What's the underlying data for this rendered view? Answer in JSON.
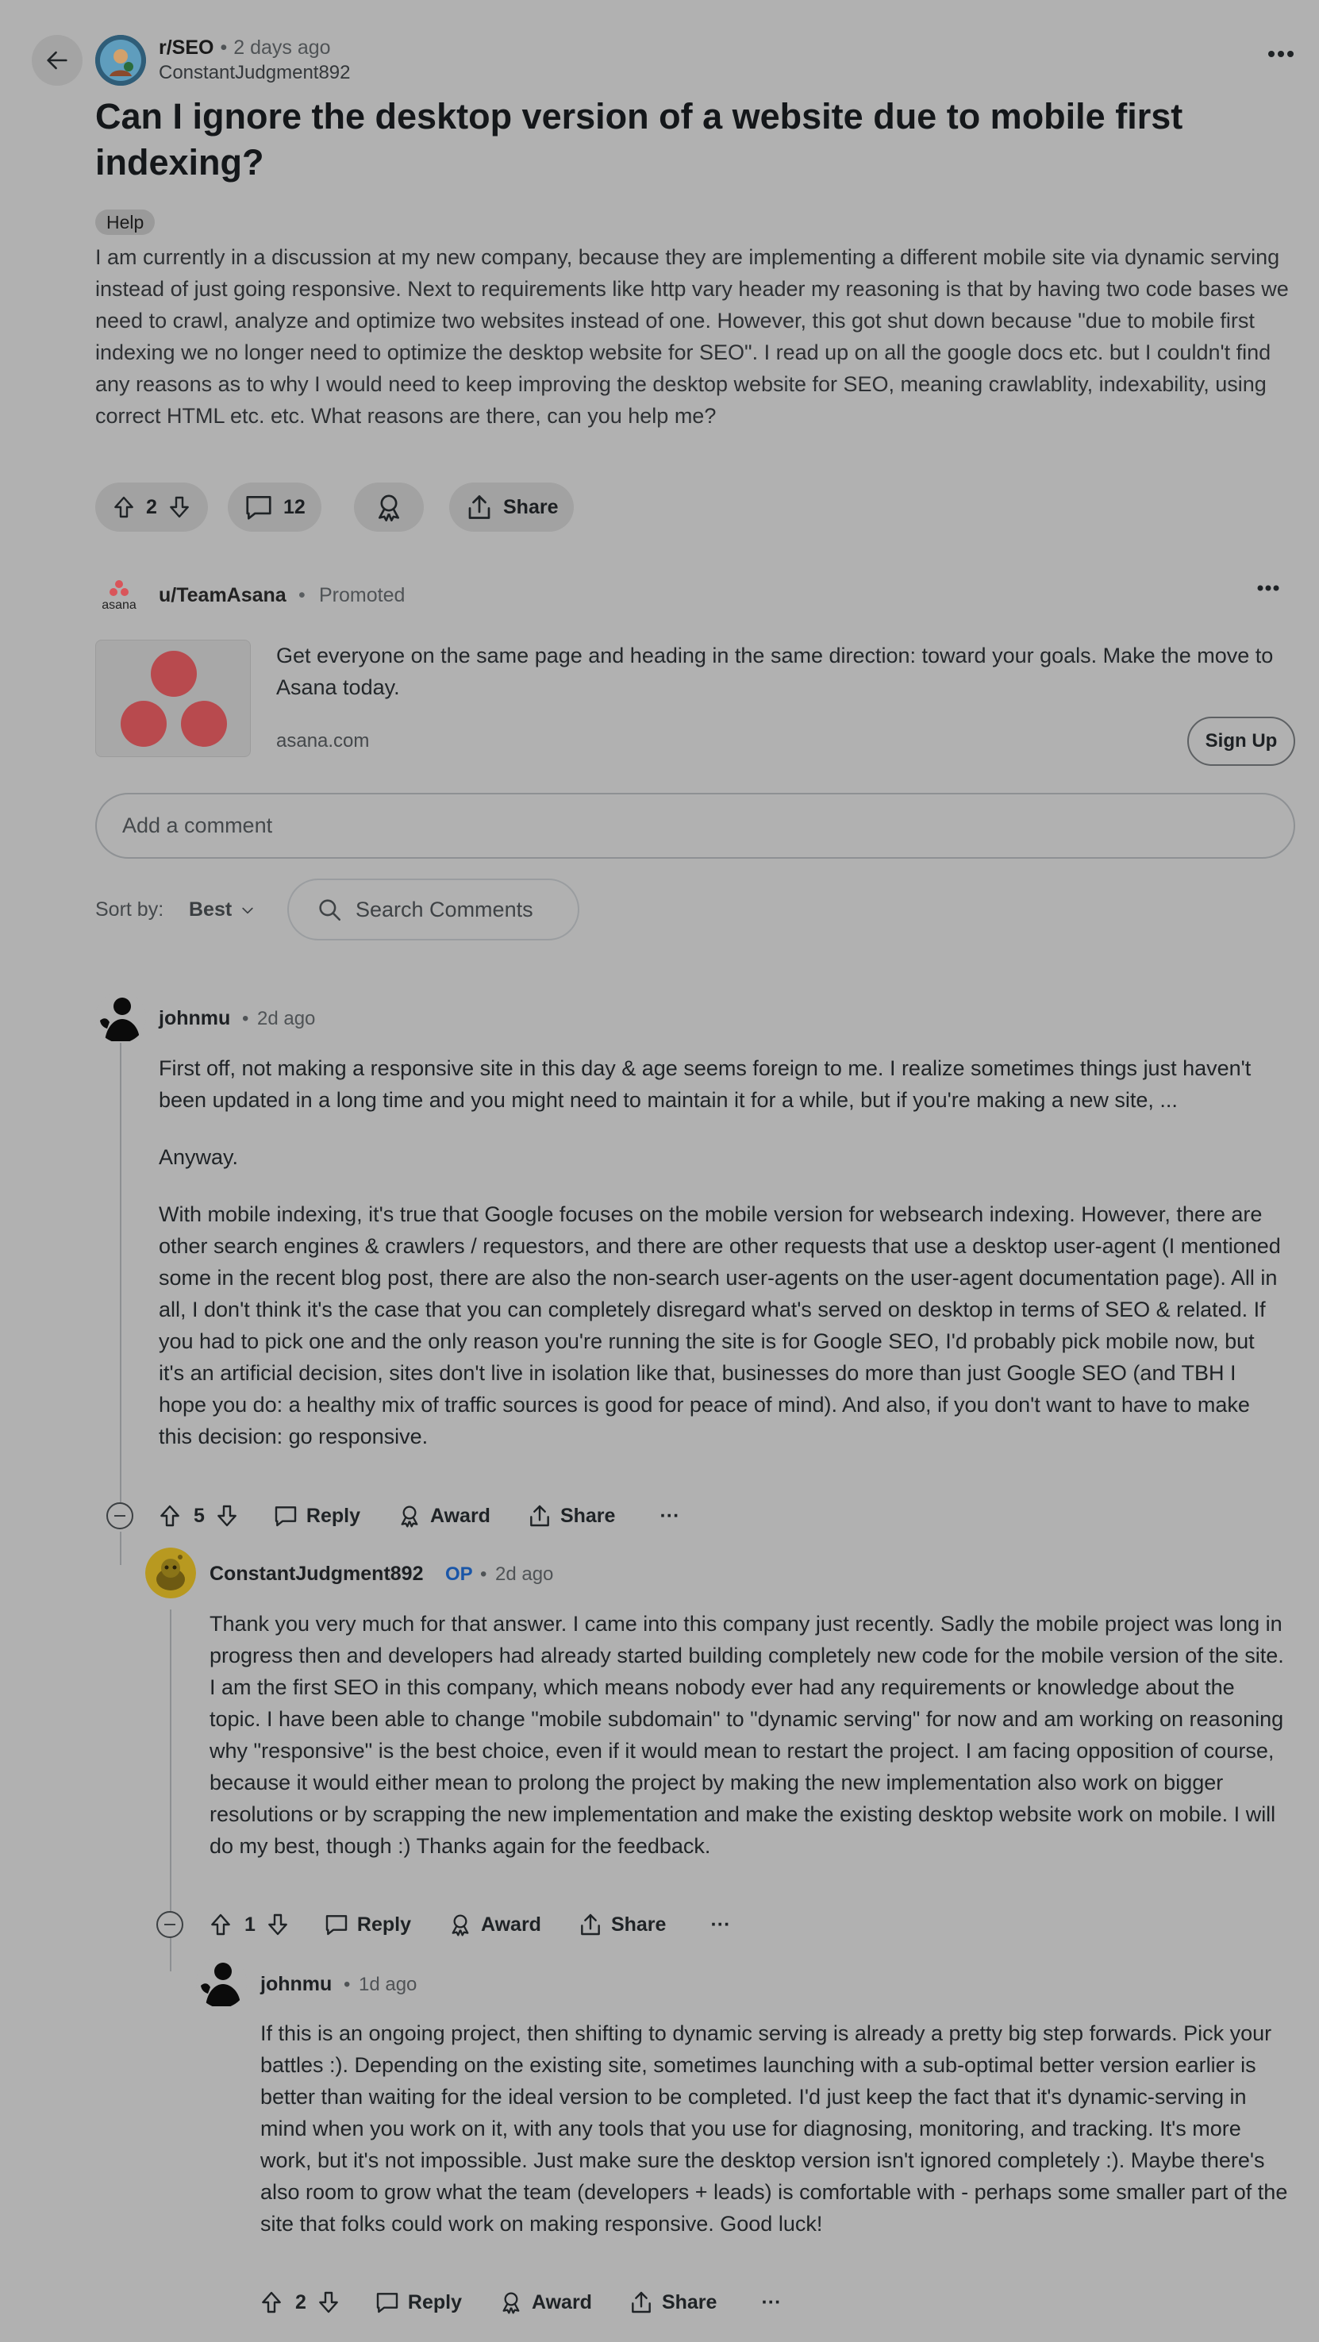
{
  "post": {
    "subreddit": "r/SEO",
    "time": "2 days ago",
    "author": "ConstantJudgment892",
    "title": "Can I ignore the desktop version of a website due to mobile first indexing?",
    "flair": "Help",
    "body": "I am currently in a discussion at my new company, because they are implementing a different mobile site via dynamic serving instead of just going responsive. Next to requirements like http vary header my reasoning is that by having two code bases we need to crawl, analyze and optimize two websites instead of one. However, this got shut down because \"due to mobile first indexing we no longer need to optimize the desktop website for SEO\". I read up on all the google docs etc. but I couldn't find any reasons as to why I would need to keep improving the desktop website for SEO, meaning crawlablity, indexability, using correct HTML etc. etc. What reasons are there, can you help me?",
    "votes": "2",
    "comments": "12",
    "share_label": "Share"
  },
  "promoted": {
    "logo_text": "asana",
    "user": "u/TeamAsana",
    "tag": "Promoted",
    "text": "Get everyone on the same page and heading in the same direction: toward your goals. Make the move to Asana today.",
    "domain": "asana.com",
    "cta": "Sign Up",
    "brand_color": "#d9555a"
  },
  "comment_box": {
    "placeholder": "Add a comment"
  },
  "sort": {
    "label": "Sort by:",
    "value": "Best"
  },
  "search_comments": {
    "placeholder": "Search Comments"
  },
  "comments": [
    {
      "user": "johnmu",
      "time": "2d ago",
      "paragraphs": [
        "First off, not making a responsive site in this day & age seems foreign to me. I realize sometimes things just haven't been updated in a long time and you might need to maintain it for a while, but if you're making a new site, ...",
        "Anyway.",
        "With mobile indexing, it's true that Google focuses on the mobile version for websearch indexing. However, there are other search engines & crawlers / requestors, and there are other requests that use a desktop user-agent (I mentioned some in the recent blog post, there are also the non-search user-agents on the user-agent documentation page). All in all, I don't think it's the case that you can completely disregard what's served on desktop in terms of SEO & related. If you had to pick one and the only reason you're running the site is for Google SEO, I'd probably pick mobile now, but it's an artificial decision, sites don't live in isolation like that, businesses do more than just Google SEO (and TBH I hope you do: a healthy mix of traffic sources is good for peace of mind). And also, if you don't want to have to make this decision: go responsive."
      ],
      "votes": "5"
    },
    {
      "user": "ConstantJudgment892",
      "op_badge": "OP",
      "time": "2d ago",
      "paragraphs": [
        "Thank you very much for that answer. I came into this company just recently. Sadly the mobile project was long in progress then and developers had already started building completely new code for the mobile version of the site. I am the first SEO in this company, which means nobody ever had any requirements or knowledge about the topic. I have been able to change \"mobile subdomain\" to \"dynamic serving\" for now and am working on reasoning why \"responsive\" is the best choice, even if it would mean to restart the project. I am facing opposition of course, because it would either mean to prolong the project by making the new implementation also work on bigger resolutions or by scrapping the new implementation and make the existing desktop website work on mobile. I will do my best, though :) Thanks again for the feedback."
      ],
      "votes": "1"
    },
    {
      "user": "johnmu",
      "time": "1d ago",
      "paragraphs": [
        "If this is an ongoing project, then shifting to dynamic serving is already a pretty big step forwards. Pick your battles :). Depending on the existing site, sometimes launching with a sub-optimal better version earlier is better than waiting for the ideal version to be completed. I'd just keep the fact that it's dynamic-serving in mind when you work on it, with any tools that you use for diagnosing, monitoring, and tracking. It's more work, but it's not impossible. Just make sure the desktop version isn't ignored completely :). Maybe there's also room to grow what the team (developers + leads) is comfortable with - perhaps some smaller part of the site that folks could work on making responsive. Good luck!"
      ],
      "votes": "2"
    }
  ],
  "actions": {
    "reply": "Reply",
    "award": "Award",
    "share": "Share",
    "more": "···"
  },
  "separator": "•"
}
